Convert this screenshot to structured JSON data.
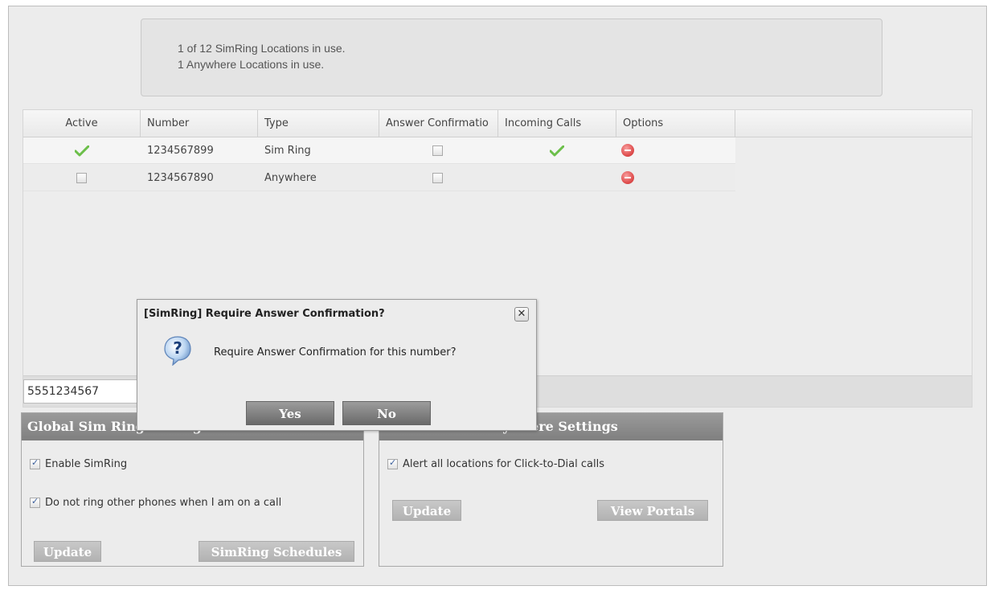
{
  "info": {
    "line1": "1 of 12 SimRing Locations in use.",
    "line2": "1 Anywhere Locations in use."
  },
  "grid": {
    "headers": [
      "Active",
      "Number",
      "Type",
      "Answer Confirmatio",
      "Incoming Calls",
      "Options"
    ],
    "rows": [
      {
        "active": "check",
        "number": "1234567899",
        "type": "Sim Ring",
        "answer_confirmation": false,
        "incoming_calls": "check",
        "options": "remove-icon"
      },
      {
        "active": "unchecked",
        "number": "1234567890",
        "type": "Anywhere",
        "answer_confirmation": false,
        "incoming_calls": "",
        "options": "remove-icon"
      }
    ],
    "new_number_value": "5551234567"
  },
  "sim_ring_panel": {
    "title": "Global Sim Ring Settings",
    "enable_label": "Enable SimRing",
    "enable_checked": true,
    "dnd_label": "Do not ring other phones when I am on a call",
    "dnd_checked": true,
    "update_label": "Update",
    "schedules_label": "SimRing Schedules"
  },
  "anywhere_panel": {
    "title": "Global Office Anywhere Settings",
    "alert_label": "Alert all locations for Click-to-Dial calls",
    "alert_checked": true,
    "update_label": "Update",
    "portals_label": "View Portals"
  },
  "dialog": {
    "title": "[SimRing] Require Answer Confirmation?",
    "message": "Require Answer Confirmation for this number?",
    "yes_label": "Yes",
    "no_label": "No",
    "close_glyph": "✕"
  },
  "colors": {
    "check_green": "#6cbf4a",
    "remove_red": "#e05050",
    "panel_title_bg": "#8a8a8a",
    "button_gray": "#b8b8b8"
  }
}
